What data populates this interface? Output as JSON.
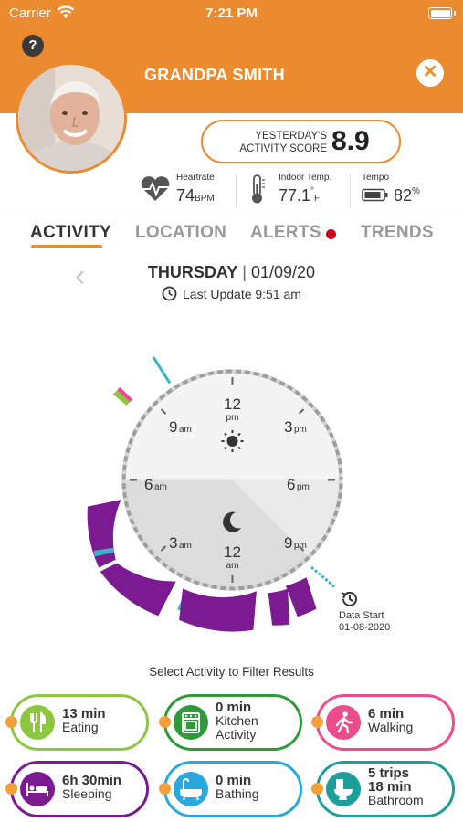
{
  "status_bar": {
    "carrier": "Carrier",
    "time": "7:21 PM"
  },
  "header": {
    "help": "?",
    "name": "GRANDPA SMITH",
    "close": "✕",
    "score_label": "YESTERDAY'S ACTIVITY SCORE",
    "score_value": "8.9"
  },
  "metrics": {
    "heartrate": {
      "label": "Heartrate",
      "value": "74",
      "unit": "BPM"
    },
    "temp": {
      "label": "Indoor Temp.",
      "value": "77.1",
      "unit_deg": "°",
      "unit": "F"
    },
    "tempo": {
      "label": "Tempo",
      "value": "82",
      "unit": "%"
    }
  },
  "tabs": [
    "ACTIVITY",
    "LOCATION",
    "ALERTS",
    "TRENDS"
  ],
  "date": {
    "day": "THURSDAY",
    "sep": "|",
    "date": "01/09/20",
    "last_update": "Last Update 9:51 am"
  },
  "clock": {
    "labels": {
      "h12pm": "12",
      "pm": "pm",
      "h3pm": "3",
      "h3pm_s": "pm",
      "h6pm": "6",
      "h6pm_s": "pm",
      "h9pm": "9",
      "h9pm_s": "pm",
      "h12am": "12",
      "am": "am",
      "h3am": "3",
      "h3am_s": "am",
      "h6am": "6",
      "h6am_s": "am",
      "h9am": "9",
      "h9am_s": "am"
    },
    "colors": {
      "sleeping": "#7b1a91",
      "eating": "#8dc63f",
      "walking": "#ec4b8c",
      "bathroom": "#3bb5c9"
    }
  },
  "data_start": {
    "label": "Data Start",
    "date": "01-08-2020"
  },
  "filter_label": "Select Activity to Filter Results",
  "activities": [
    {
      "value": "13 min",
      "label": "Eating",
      "color": "#8dc63f"
    },
    {
      "value": "0 min",
      "label1": "Kitchen",
      "label2": "Activity",
      "color": "#2e9a3a"
    },
    {
      "value": "6 min",
      "label": "Walking",
      "color": "#ec4b8c"
    },
    {
      "value": "6h 30min",
      "label": "Sleeping",
      "color": "#7b1a91"
    },
    {
      "value": "0 min",
      "label": "Bathing",
      "color": "#29a8e0"
    },
    {
      "value1": "5 trips",
      "value2": "18 min",
      "label": "Bathroom",
      "color": "#1c9e9a"
    }
  ]
}
